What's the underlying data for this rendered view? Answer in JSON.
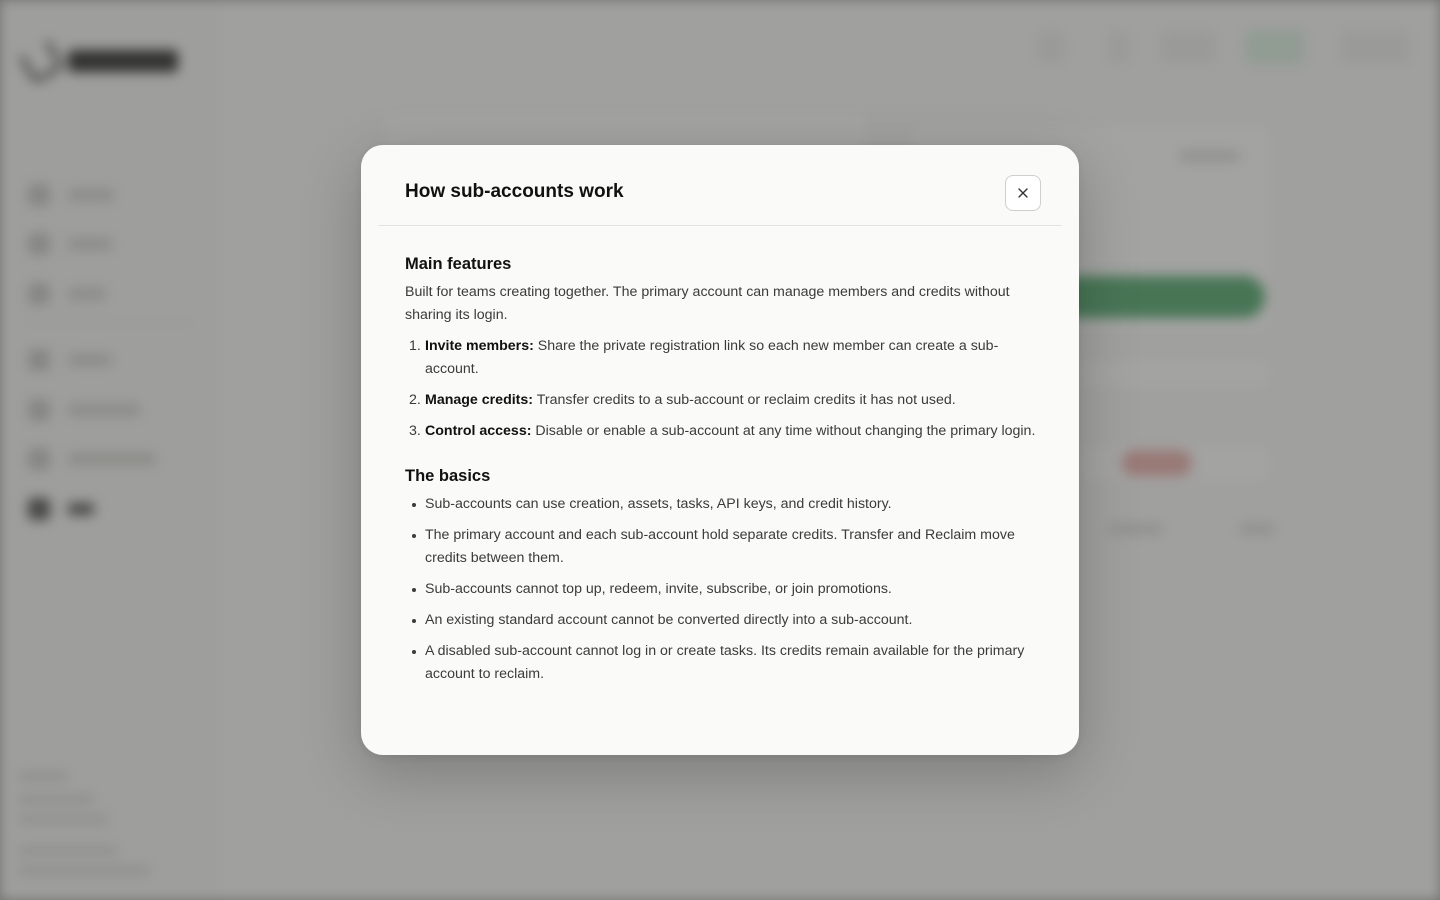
{
  "modal": {
    "title": "How sub-accounts work",
    "close_icon": "close-icon",
    "main_features": {
      "heading": "Main features",
      "intro": "Built for teams creating together. The primary account can manage members and credits without sharing its login.",
      "steps": [
        {
          "number": "1.",
          "label": "Invite members:",
          "text": " Share the private registration link so each new member can create a sub-account."
        },
        {
          "number": "2.",
          "label": "Manage credits:",
          "text": " Transfer credits to a sub-account or reclaim credits it has not used."
        },
        {
          "number": "3.",
          "label": "Control access:",
          "text": " Disable or enable a sub-account at any time without changing the primary login."
        }
      ]
    },
    "basics": {
      "heading": "The basics",
      "items": [
        "Sub-accounts can use creation, assets, tasks, API keys, and credit history.",
        "The primary account and each sub-account hold separate credits. Transfer and Reclaim move credits between them.",
        "Sub-accounts cannot top up, redeem, invite, subscribe, or join promotions.",
        "An existing standard account cannot be converted directly into a sub-account.",
        "A disabled sub-account cannot log in or create tasks. Its credits remain available for the primary account to reclaim."
      ]
    }
  },
  "colors": {
    "accent_green": "#5fae78",
    "scrim": "rgba(40,40,38,0.42)",
    "modal_bg": "#fafaf9"
  }
}
